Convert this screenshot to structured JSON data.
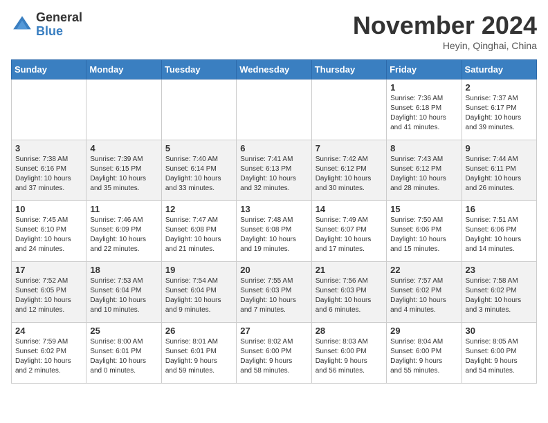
{
  "header": {
    "logo_general": "General",
    "logo_blue": "Blue",
    "month_title": "November 2024",
    "location": "Heyin, Qinghai, China"
  },
  "weekdays": [
    "Sunday",
    "Monday",
    "Tuesday",
    "Wednesday",
    "Thursday",
    "Friday",
    "Saturday"
  ],
  "weeks": [
    [
      {
        "day": "",
        "info": ""
      },
      {
        "day": "",
        "info": ""
      },
      {
        "day": "",
        "info": ""
      },
      {
        "day": "",
        "info": ""
      },
      {
        "day": "",
        "info": ""
      },
      {
        "day": "1",
        "info": "Sunrise: 7:36 AM\nSunset: 6:18 PM\nDaylight: 10 hours\nand 41 minutes."
      },
      {
        "day": "2",
        "info": "Sunrise: 7:37 AM\nSunset: 6:17 PM\nDaylight: 10 hours\nand 39 minutes."
      }
    ],
    [
      {
        "day": "3",
        "info": "Sunrise: 7:38 AM\nSunset: 6:16 PM\nDaylight: 10 hours\nand 37 minutes."
      },
      {
        "day": "4",
        "info": "Sunrise: 7:39 AM\nSunset: 6:15 PM\nDaylight: 10 hours\nand 35 minutes."
      },
      {
        "day": "5",
        "info": "Sunrise: 7:40 AM\nSunset: 6:14 PM\nDaylight: 10 hours\nand 33 minutes."
      },
      {
        "day": "6",
        "info": "Sunrise: 7:41 AM\nSunset: 6:13 PM\nDaylight: 10 hours\nand 32 minutes."
      },
      {
        "day": "7",
        "info": "Sunrise: 7:42 AM\nSunset: 6:12 PM\nDaylight: 10 hours\nand 30 minutes."
      },
      {
        "day": "8",
        "info": "Sunrise: 7:43 AM\nSunset: 6:12 PM\nDaylight: 10 hours\nand 28 minutes."
      },
      {
        "day": "9",
        "info": "Sunrise: 7:44 AM\nSunset: 6:11 PM\nDaylight: 10 hours\nand 26 minutes."
      }
    ],
    [
      {
        "day": "10",
        "info": "Sunrise: 7:45 AM\nSunset: 6:10 PM\nDaylight: 10 hours\nand 24 minutes."
      },
      {
        "day": "11",
        "info": "Sunrise: 7:46 AM\nSunset: 6:09 PM\nDaylight: 10 hours\nand 22 minutes."
      },
      {
        "day": "12",
        "info": "Sunrise: 7:47 AM\nSunset: 6:08 PM\nDaylight: 10 hours\nand 21 minutes."
      },
      {
        "day": "13",
        "info": "Sunrise: 7:48 AM\nSunset: 6:08 PM\nDaylight: 10 hours\nand 19 minutes."
      },
      {
        "day": "14",
        "info": "Sunrise: 7:49 AM\nSunset: 6:07 PM\nDaylight: 10 hours\nand 17 minutes."
      },
      {
        "day": "15",
        "info": "Sunrise: 7:50 AM\nSunset: 6:06 PM\nDaylight: 10 hours\nand 15 minutes."
      },
      {
        "day": "16",
        "info": "Sunrise: 7:51 AM\nSunset: 6:06 PM\nDaylight: 10 hours\nand 14 minutes."
      }
    ],
    [
      {
        "day": "17",
        "info": "Sunrise: 7:52 AM\nSunset: 6:05 PM\nDaylight: 10 hours\nand 12 minutes."
      },
      {
        "day": "18",
        "info": "Sunrise: 7:53 AM\nSunset: 6:04 PM\nDaylight: 10 hours\nand 10 minutes."
      },
      {
        "day": "19",
        "info": "Sunrise: 7:54 AM\nSunset: 6:04 PM\nDaylight: 10 hours\nand 9 minutes."
      },
      {
        "day": "20",
        "info": "Sunrise: 7:55 AM\nSunset: 6:03 PM\nDaylight: 10 hours\nand 7 minutes."
      },
      {
        "day": "21",
        "info": "Sunrise: 7:56 AM\nSunset: 6:03 PM\nDaylight: 10 hours\nand 6 minutes."
      },
      {
        "day": "22",
        "info": "Sunrise: 7:57 AM\nSunset: 6:02 PM\nDaylight: 10 hours\nand 4 minutes."
      },
      {
        "day": "23",
        "info": "Sunrise: 7:58 AM\nSunset: 6:02 PM\nDaylight: 10 hours\nand 3 minutes."
      }
    ],
    [
      {
        "day": "24",
        "info": "Sunrise: 7:59 AM\nSunset: 6:02 PM\nDaylight: 10 hours\nand 2 minutes."
      },
      {
        "day": "25",
        "info": "Sunrise: 8:00 AM\nSunset: 6:01 PM\nDaylight: 10 hours\nand 0 minutes."
      },
      {
        "day": "26",
        "info": "Sunrise: 8:01 AM\nSunset: 6:01 PM\nDaylight: 9 hours\nand 59 minutes."
      },
      {
        "day": "27",
        "info": "Sunrise: 8:02 AM\nSunset: 6:00 PM\nDaylight: 9 hours\nand 58 minutes."
      },
      {
        "day": "28",
        "info": "Sunrise: 8:03 AM\nSunset: 6:00 PM\nDaylight: 9 hours\nand 56 minutes."
      },
      {
        "day": "29",
        "info": "Sunrise: 8:04 AM\nSunset: 6:00 PM\nDaylight: 9 hours\nand 55 minutes."
      },
      {
        "day": "30",
        "info": "Sunrise: 8:05 AM\nSunset: 6:00 PM\nDaylight: 9 hours\nand 54 minutes."
      }
    ]
  ]
}
